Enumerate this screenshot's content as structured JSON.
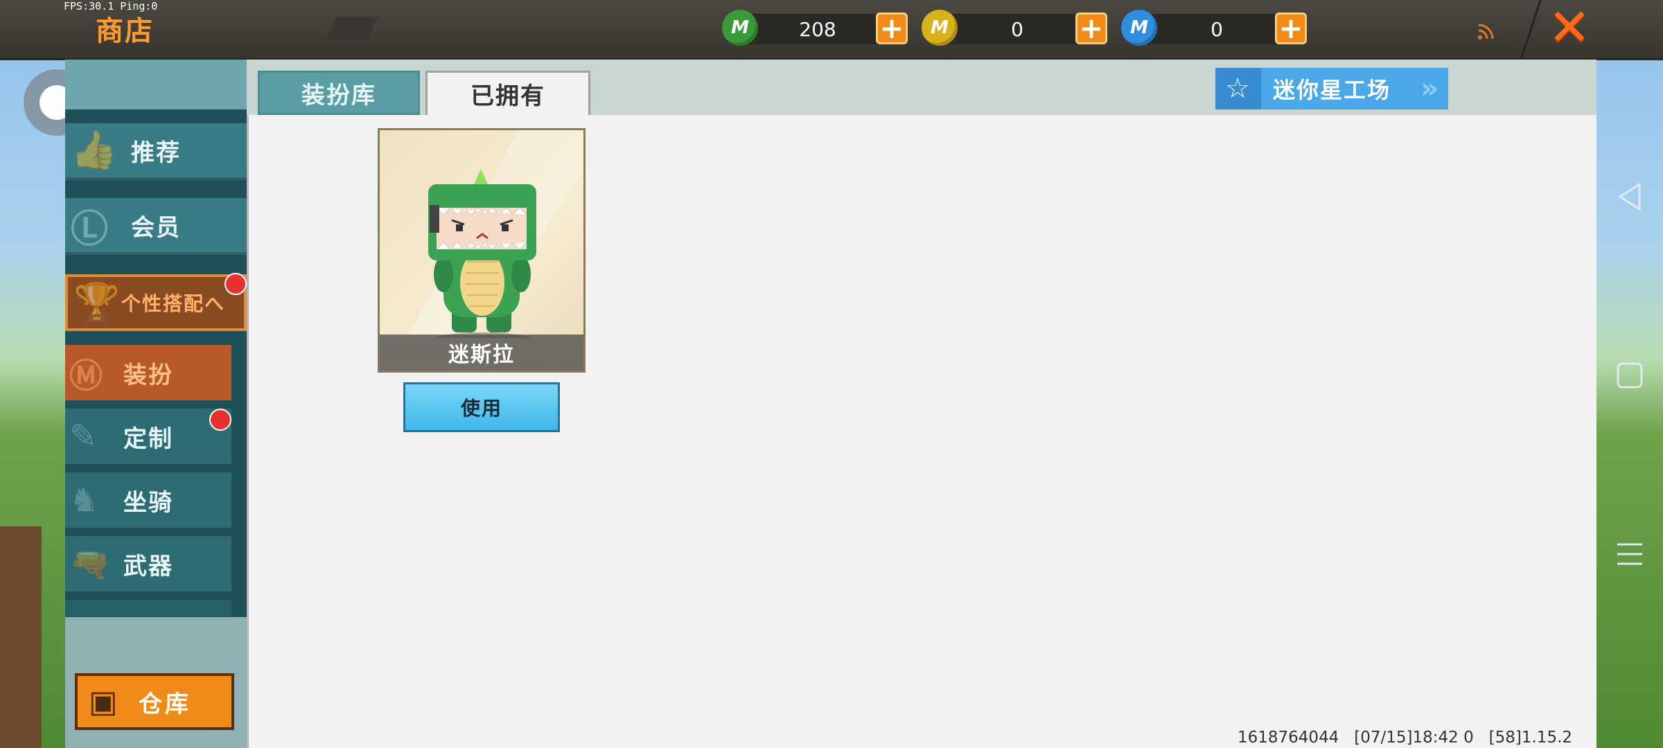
{
  "header": {
    "fps_text": "FPS:30.1 Ping:0",
    "title": "商店",
    "currencies": [
      {
        "icon": "green-mini-coin-icon",
        "symbol": "M",
        "value": "208",
        "color": "#3a9a3a"
      },
      {
        "icon": "gold-mini-coin-icon",
        "symbol": "M",
        "value": "0",
        "color": "#d8b21c"
      },
      {
        "icon": "blue-mini-coin-icon",
        "symbol": "M",
        "value": "0",
        "color": "#2f8ee0"
      }
    ],
    "plus_label": "+",
    "signal_icon": "rss-signal-icon",
    "close_label": "✕"
  },
  "sidebar": {
    "items": [
      {
        "label": "推荐",
        "icon": "thumbs-up-icon"
      },
      {
        "label": "会员",
        "icon": "vip-badge-icon"
      },
      {
        "label": "个性搭配へ",
        "icon": "trophy-icon"
      }
    ],
    "sub_items": [
      {
        "label": "装扮",
        "icon": "m-shirt-icon"
      },
      {
        "label": "定制",
        "icon": "pencil-icon"
      },
      {
        "label": "坐骑",
        "icon": "mount-icon"
      },
      {
        "label": "武器",
        "icon": "revolver-icon"
      }
    ],
    "warehouse_label": "仓库"
  },
  "tabs": [
    {
      "label": "装扮库"
    },
    {
      "label": "已拥有"
    }
  ],
  "workshop_label": "迷你星工场",
  "item": {
    "name": "迷斯拉",
    "use_label": "使用"
  },
  "footer": {
    "info_text": "1618764044   [07/15]18:42 0   [58]1.15.2"
  },
  "colors": {
    "accent_orange": "#f08a18",
    "sidebar_teal": "#3a7c86",
    "active_orange": "#b85a28",
    "button_blue": "#3fb6ea"
  }
}
